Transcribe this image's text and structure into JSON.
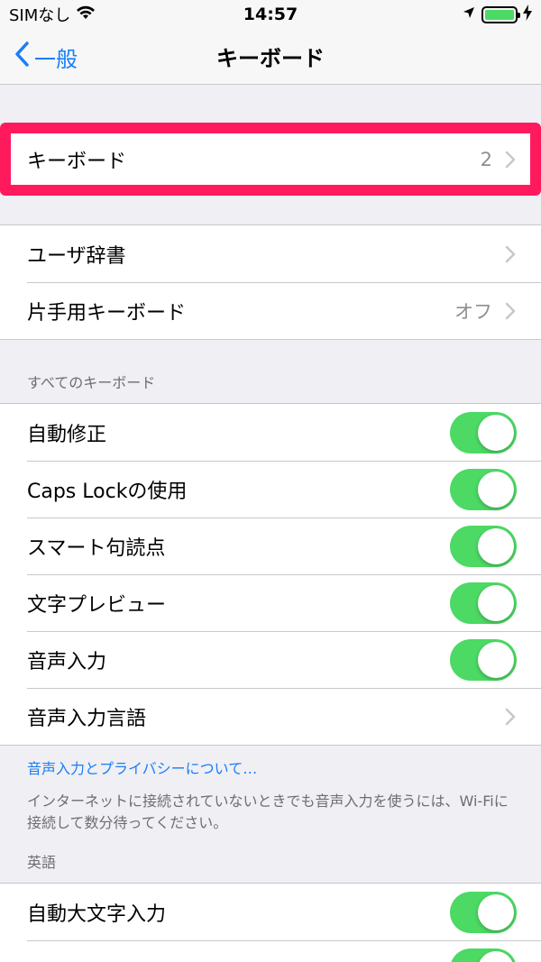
{
  "status_bar": {
    "carrier": "SIMなし",
    "time": "14:57",
    "battery_level": 1.0
  },
  "nav": {
    "back_label": "一般",
    "title": "キーボード"
  },
  "keyboards_row": {
    "label": "キーボード",
    "value": "2"
  },
  "group2": [
    {
      "label": "ユーザ辞書",
      "value": ""
    },
    {
      "label": "片手用キーボード",
      "value": "オフ"
    }
  ],
  "all_keyboards": {
    "header": "すべてのキーボード",
    "rows": [
      {
        "label": "自動修正",
        "on": true
      },
      {
        "label": "Caps Lockの使用",
        "on": true
      },
      {
        "label": "スマート句読点",
        "on": true
      },
      {
        "label": "文字プレビュー",
        "on": true
      },
      {
        "label": "音声入力",
        "on": true
      },
      {
        "label": "音声入力言語"
      }
    ],
    "footer_link": "音声入力とプライバシーについて…",
    "footer_note": "インターネットに接続されていないときでも音声入力を使うには、Wi-Fiに接続して数分待ってください。"
  },
  "english": {
    "header": "英語",
    "rows": [
      {
        "label": "自動大文字入力",
        "on": true
      }
    ]
  },
  "colors": {
    "accent": "#1a7ef7",
    "toggle_on": "#4cd964",
    "highlight": "#ff1a5e"
  }
}
